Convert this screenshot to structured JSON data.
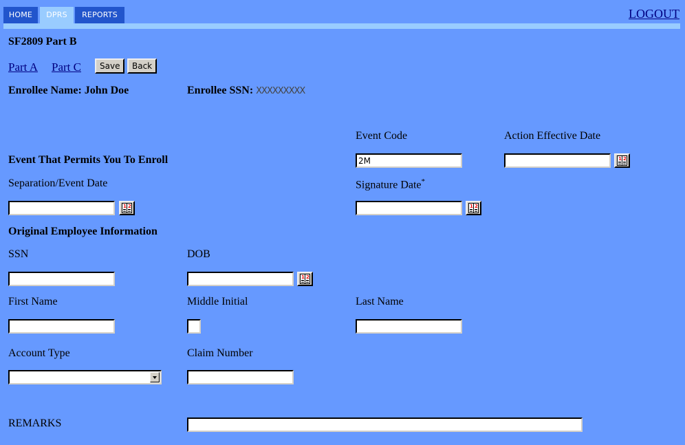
{
  "nav": {
    "tabs": [
      {
        "label": "HOME",
        "active": false
      },
      {
        "label": "DPRS",
        "active": true
      },
      {
        "label": "REPORTS",
        "active": false
      }
    ],
    "logout_label": "LOGOUT"
  },
  "page": {
    "title": "SF2809 Part B",
    "links": {
      "part_a": "Part A",
      "part_c": "Part C"
    },
    "buttons": {
      "save": "Save",
      "back": "Back"
    },
    "enrollee_name_label": "Enrollee Name:",
    "enrollee_name_value": "John Doe",
    "enrollee_ssn_label": "Enrollee SSN:",
    "enrollee_ssn_value": "XXXXXXXXX"
  },
  "form": {
    "event_section": {
      "heading": "Event That Permits You To Enroll",
      "event_code": {
        "label": "Event Code",
        "value": "2M"
      },
      "action_effective_date": {
        "label": "Action Effective Date",
        "value": ""
      },
      "separation_event_date": {
        "label": "Separation/Event Date",
        "value": ""
      },
      "signature_date": {
        "label": "Signature Date",
        "required_marker": "*",
        "value": ""
      }
    },
    "employee_section": {
      "heading": "Original Employee Information",
      "ssn": {
        "label": "SSN",
        "value": ""
      },
      "dob": {
        "label": "DOB",
        "value": ""
      },
      "first_name": {
        "label": "First Name",
        "value": ""
      },
      "middle_initial": {
        "label": "Middle Initial",
        "value": ""
      },
      "last_name": {
        "label": "Last Name",
        "value": ""
      },
      "account_type": {
        "label": "Account Type",
        "selected": ""
      },
      "claim_number": {
        "label": "Claim Number",
        "value": ""
      }
    },
    "remarks": {
      "label": "REMARKS",
      "value": ""
    }
  },
  "icons": {
    "calendar": "calendar-icon",
    "dropdown": "chevron-down-icon"
  }
}
